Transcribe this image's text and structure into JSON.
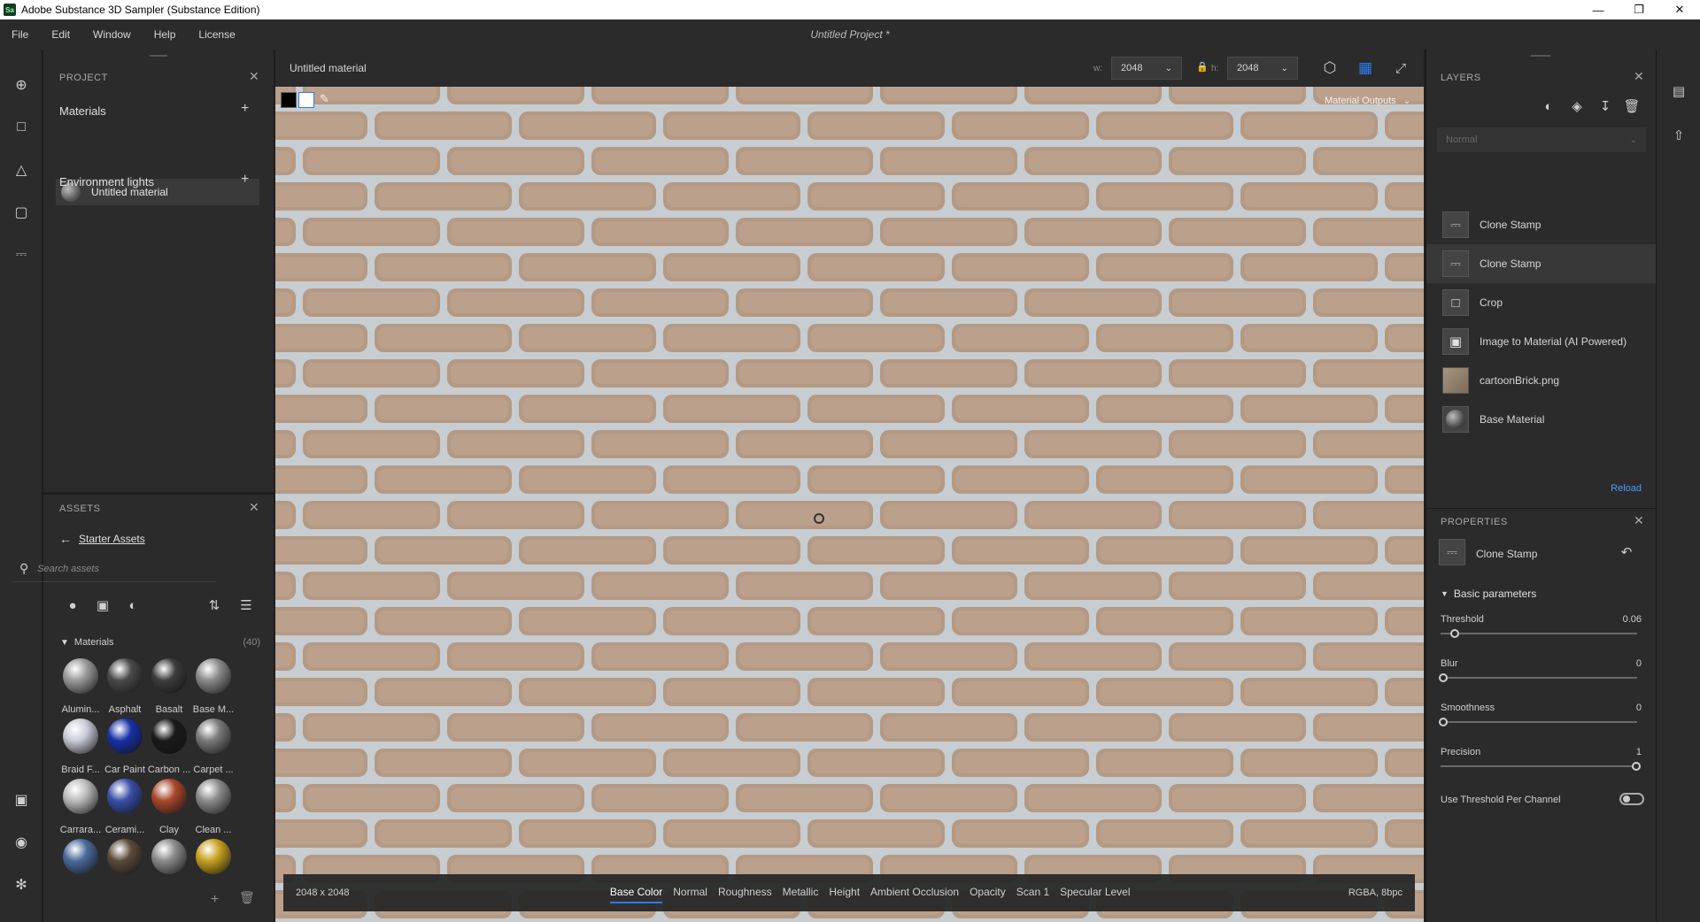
{
  "window": {
    "title": "Adobe Substance 3D Sampler (Substance Edition)",
    "app_badge": "Sa"
  },
  "menu": {
    "items": [
      "File",
      "Edit",
      "Window",
      "Help",
      "License"
    ],
    "project_title": "Untitled Project *"
  },
  "project": {
    "header": "PROJECT",
    "materials_label": "Materials",
    "material_item": "Untitled material",
    "env_lights_label": "Environment lights"
  },
  "assets": {
    "header": "ASSETS",
    "breadcrumb": "Starter Assets",
    "search_placeholder": "Search assets",
    "section_label": "Materials",
    "section_count": "(40)",
    "items": [
      {
        "label": "Alumin...",
        "color": "#9a9a9a"
      },
      {
        "label": "Asphalt",
        "color": "#4a4a4a"
      },
      {
        "label": "Basalt",
        "color": "#3c3c3c"
      },
      {
        "label": "Base M...",
        "color": "#8a8a8a"
      },
      {
        "label": "Braid F...",
        "color": "#c8ccd8"
      },
      {
        "label": "Car Paint",
        "color": "#1830a8"
      },
      {
        "label": "Carbon ...",
        "color": "#1a1a1a"
      },
      {
        "label": "Carpet ...",
        "color": "#7a7a7a"
      },
      {
        "label": "Carrara...",
        "color": "#bcbcbc"
      },
      {
        "label": "Cerami...",
        "color": "#3a4fa8"
      },
      {
        "label": "Clay",
        "color": "#a8482c"
      },
      {
        "label": "Clean ...",
        "color": "#8c8c8c"
      },
      {
        "label": "",
        "color": "#4a6a9a"
      },
      {
        "label": "",
        "color": "#5a4a3a"
      },
      {
        "label": "",
        "color": "#8a8a8a"
      },
      {
        "label": "",
        "color": "#c8a020"
      }
    ]
  },
  "viewport": {
    "material_name": "Untitled material",
    "width_label": "w:",
    "width_value": "2048",
    "height_label": "h:",
    "height_value": "2048",
    "outputs_label": "Material Outputs",
    "resolution": "2048 x 2048",
    "format": "RGBA, 8bpc",
    "tabs": [
      "Base Color",
      "Normal",
      "Roughness",
      "Metallic",
      "Height",
      "Ambient Occlusion",
      "Opacity",
      "Scan 1",
      "Specular Level"
    ],
    "active_tab": "Base Color"
  },
  "layers": {
    "header": "LAYERS",
    "blend_mode": "Normal",
    "items": [
      {
        "name": "Clone Stamp",
        "icon": "stamp-icon"
      },
      {
        "name": "Clone Stamp",
        "icon": "stamp-icon"
      },
      {
        "name": "Crop",
        "icon": "crop-icon"
      },
      {
        "name": "Image to Material (AI Powered)",
        "icon": "image-to-material-icon"
      },
      {
        "name": "cartoonBrick.png",
        "icon": "image-thumbnail"
      },
      {
        "name": "Base Material",
        "icon": "material-ball-icon"
      }
    ],
    "reload_label": "Reload"
  },
  "properties": {
    "header": "PROPERTIES",
    "layer_name": "Clone Stamp",
    "section": "Basic parameters",
    "params": [
      {
        "label": "Threshold",
        "value": "0.06",
        "fraction": 0.06
      },
      {
        "label": "Blur",
        "value": "0",
        "fraction": 0
      },
      {
        "label": "Smoothness",
        "value": "0",
        "fraction": 0
      },
      {
        "label": "Precision",
        "value": "1",
        "fraction": 1
      }
    ],
    "toggle_label": "Use Threshold Per Channel",
    "toggle_on": false
  },
  "colors": {
    "accent": "#2d7bf0",
    "link": "#4a9cff"
  }
}
